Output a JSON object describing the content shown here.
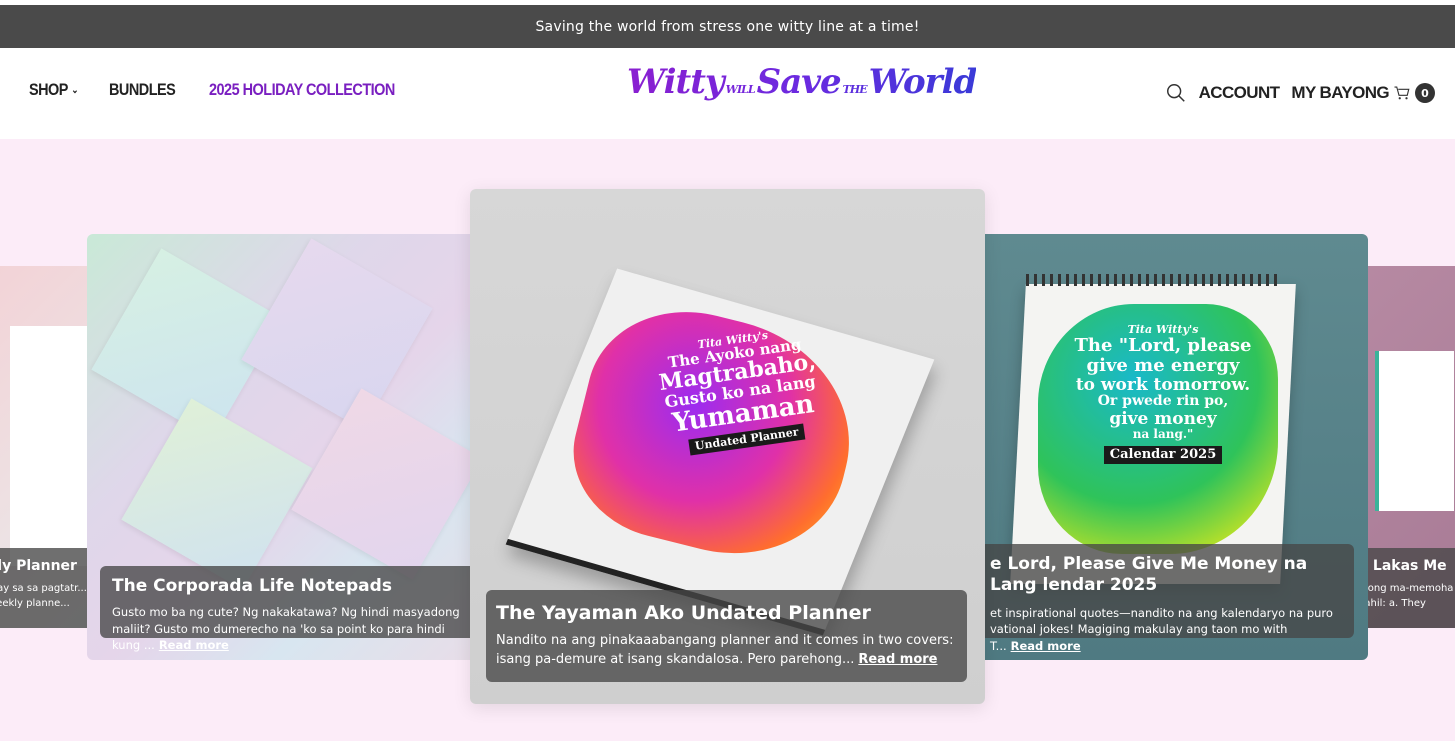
{
  "announcement": "Saving the world from stress one witty line at a time!",
  "nav": {
    "shop": "SHOP",
    "bundles": "BUNDLES",
    "holiday": "2025 HOLIDAY COLLECTION"
  },
  "logo": {
    "part1": "Witty",
    "part2": "WILL",
    "part3": "Save",
    "part4": "THE",
    "part5": "World"
  },
  "account": "ACCOUNT",
  "cart": {
    "label": "MY BAYONG",
    "count": "0"
  },
  "slides": [
    {
      "title": "kly Planner",
      "text": "inay sa sa pagtatr... these weekly planne...",
      "more": ""
    },
    {
      "title": "The Corporada Life Notepads",
      "text": "Gusto mo ba ng cute? Ng nakakatawa? Ng hindi masyadong maliit? Gusto mo dumerecho na 'ko sa point ko para hindi kung ...",
      "more": "Read more"
    },
    {
      "title": "The Yayaman Ako Undated Planner",
      "text": "Nandito na ang pinakaaabangang planner and it comes in two covers: isang pa-demure at isang skandalosa. Pero parehong...",
      "more": "Read more",
      "cover_lines": [
        "Tita Witty's",
        "The Ayoko nang",
        "Magtrabaho,",
        "Gusto ko na lang",
        "Yumaman",
        "Undated Planner"
      ]
    },
    {
      "title": "e Lord, Please Give Me Money na Lang lendar 2025",
      "text": "et inspirational quotes—nandito na ang kalendaryo na puro vational jokes! Magiging makulay ang taon mo with T...",
      "more": "Read more",
      "cover_lines": [
        "Tita Witty's",
        "The \"Lord, please",
        "give me energy",
        "to work tomorrow.",
        "Or pwede rin po,",
        "give money",
        "na lang.\"",
        "Calendar 2025"
      ]
    },
    {
      "title": "g Lakas Me",
      "text": "mong ma-memoha 'to dahil: a. They",
      "more": ""
    }
  ]
}
